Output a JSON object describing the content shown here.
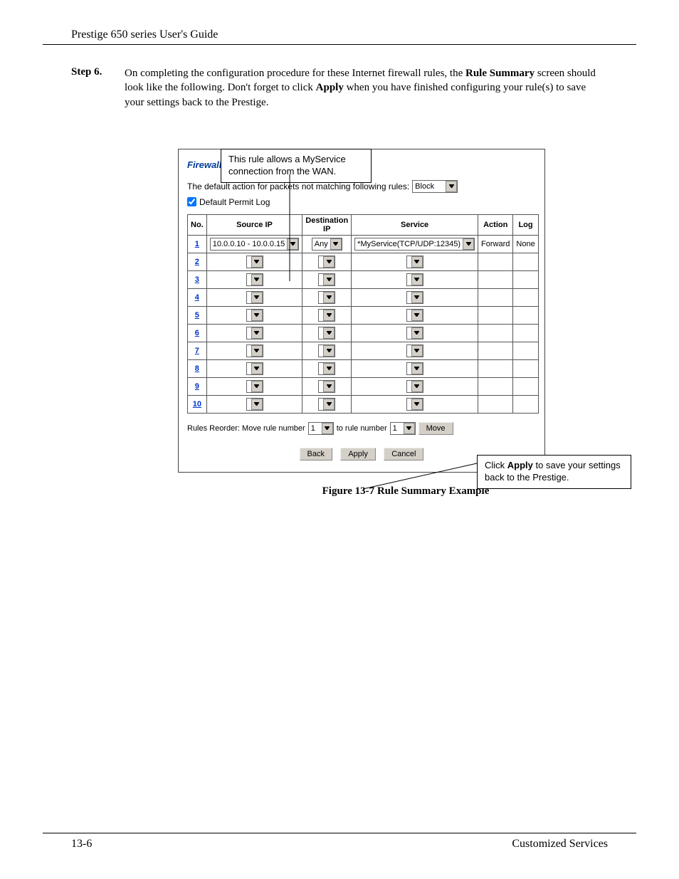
{
  "header": "Prestige 650 series User's Guide",
  "step": {
    "label": "Step 6.",
    "text_parts": [
      "On completing the configuration procedure for these Internet firewall rules, the ",
      "Rule Summary",
      " screen should look like the following. Don't forget to click ",
      "Apply",
      " when you have finished configuring your rule(s) to save your settings back to the Prestige."
    ]
  },
  "callout_top": "This rule allows a MyService connection from the WAN.",
  "callout_right_parts": [
    "Click ",
    "Apply",
    " to save your settings back to the Prestige."
  ],
  "ui": {
    "title": "Firewall - WAN to LAN - Rule Summary",
    "default_action_label": "The default action for packets not matching following rules:",
    "default_action_value": "Block",
    "permit_log_label": "Default Permit Log",
    "permit_log_checked": true,
    "columns": [
      "No.",
      "Source IP",
      "Destination IP",
      "Service",
      "Action",
      "Log"
    ],
    "rows": [
      {
        "no": "1",
        "src": "10.0.0.10 - 10.0.0.15",
        "dst": "Any",
        "svc": "*MyService(TCP/UDP:12345)",
        "action": "Forward",
        "log": "None"
      },
      {
        "no": "2",
        "src": "",
        "dst": "",
        "svc": "",
        "action": "",
        "log": ""
      },
      {
        "no": "3",
        "src": "",
        "dst": "",
        "svc": "",
        "action": "",
        "log": ""
      },
      {
        "no": "4",
        "src": "",
        "dst": "",
        "svc": "",
        "action": "",
        "log": ""
      },
      {
        "no": "5",
        "src": "",
        "dst": "",
        "svc": "",
        "action": "",
        "log": ""
      },
      {
        "no": "6",
        "src": "",
        "dst": "",
        "svc": "",
        "action": "",
        "log": ""
      },
      {
        "no": "7",
        "src": "",
        "dst": "",
        "svc": "",
        "action": "",
        "log": ""
      },
      {
        "no": "8",
        "src": "",
        "dst": "",
        "svc": "",
        "action": "",
        "log": ""
      },
      {
        "no": "9",
        "src": "",
        "dst": "",
        "svc": "",
        "action": "",
        "log": ""
      },
      {
        "no": "10",
        "src": "",
        "dst": "",
        "svc": "",
        "action": "",
        "log": ""
      }
    ],
    "reorder": {
      "label1": "Rules Reorder: Move rule number",
      "from": "1",
      "label2": "to rule number",
      "to": "1",
      "move_btn": "Move"
    },
    "buttons": {
      "back": "Back",
      "apply": "Apply",
      "cancel": "Cancel"
    }
  },
  "caption": "Figure 13-7 Rule Summary Example",
  "footer": {
    "left": "13-6",
    "right": "Customized Services"
  }
}
